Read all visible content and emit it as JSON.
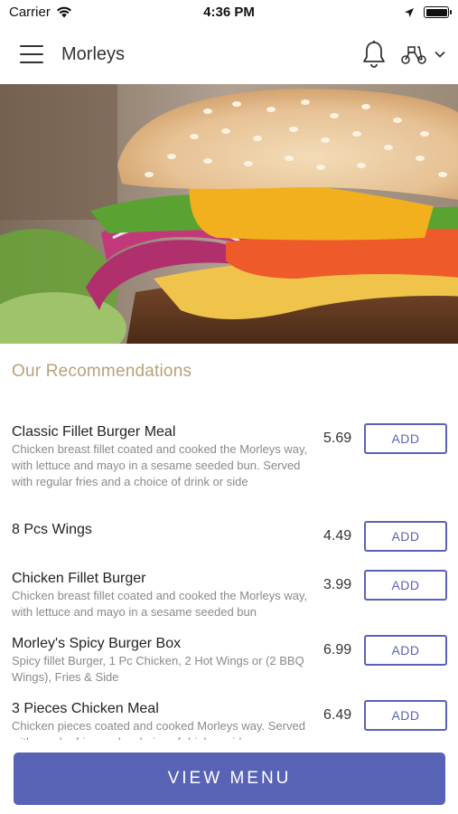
{
  "status_bar": {
    "carrier": "Carrier",
    "time": "4:36 PM"
  },
  "header": {
    "title": "Morleys",
    "icons": [
      "hamburger-menu-icon",
      "bell-icon",
      "scooter-icon",
      "chevron-down-icon"
    ]
  },
  "hero": {
    "image": "burger-photo"
  },
  "section": {
    "title": "Our Recommendations"
  },
  "menu_items": [
    {
      "name": "Classic Fillet Burger Meal",
      "description": "Chicken breast fillet coated and cooked the Morleys way, with lettuce and mayo in a sesame seeded bun. Served with regular fries and a choice of drink or side",
      "price": "5.69",
      "button": "ADD"
    },
    {
      "name": "8 Pcs Wings",
      "description": "",
      "price": "4.49",
      "button": "ADD"
    },
    {
      "name": "Chicken Fillet Burger",
      "description": "Chicken breast fillet coated and cooked the Morleys way, with lettuce and mayo in a sesame seeded bun",
      "price": "3.99",
      "button": "ADD"
    },
    {
      "name": "Morley's Spicy Burger Box",
      "description": "Spicy fillet Burger, 1 Pc Chicken, 2 Hot Wings or (2 BBQ Wings), Fries & Side",
      "price": "6.99",
      "button": "ADD"
    },
    {
      "name": "3 Pieces Chicken Meal",
      "description": "Chicken pieces coated and cooked Morleys way. Served with regular fries and a choice of drink or side",
      "price": "6.49",
      "button": "ADD"
    }
  ],
  "footer": {
    "view_menu_label": "VIEW MENU"
  },
  "colors": {
    "accent": "#5863b5",
    "section_title": "#b8a27a",
    "description": "#8a8a8a"
  }
}
